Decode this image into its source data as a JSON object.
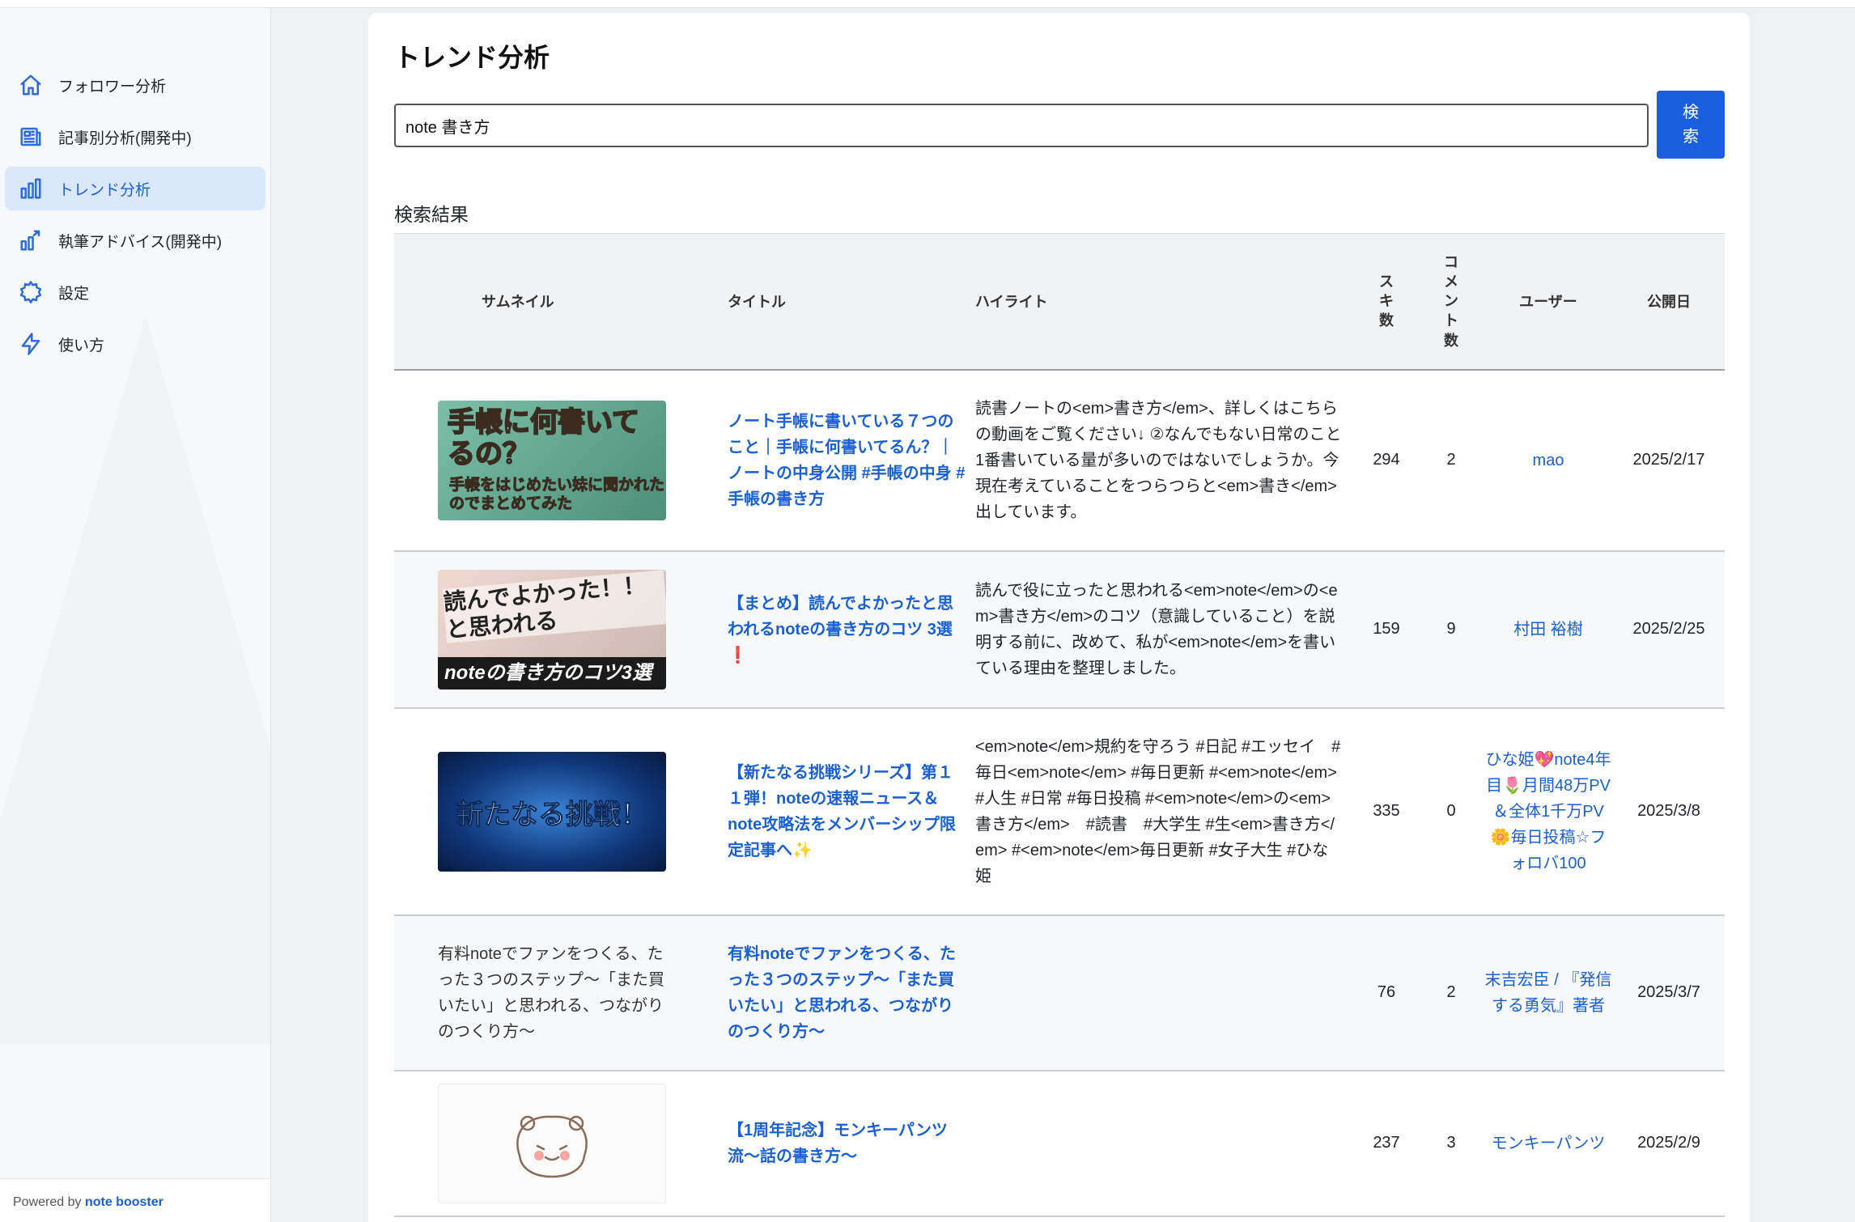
{
  "sidebar": {
    "items": [
      {
        "label": "フォロワー分析",
        "icon": "home-icon"
      },
      {
        "label": "記事別分析(開発中)",
        "icon": "article-icon"
      },
      {
        "label": "トレンド分析",
        "icon": "bar-chart-icon",
        "active": true
      },
      {
        "label": "執筆アドバイス(開発中)",
        "icon": "chart-growth-icon"
      },
      {
        "label": "設定",
        "icon": "gear-icon"
      },
      {
        "label": "使い方",
        "icon": "lightning-icon"
      }
    ],
    "powered_prefix": "Powered by",
    "powered_brand": "note booster"
  },
  "page": {
    "title": "トレンド分析",
    "search_value": "note 書き方",
    "search_button": "検索",
    "results_label": "検索結果"
  },
  "table": {
    "headers": {
      "thumb": "サムネイル",
      "title": "タイトル",
      "highlight": "ハイライト",
      "suki": "スキ数",
      "comments": "コメント数",
      "user": "ユーザー",
      "date": "公開日"
    },
    "rows": [
      {
        "thumb_text": "手帳に何書いてるの？",
        "thumb_sub": "手帳をはじめたい妹に聞かれたのでまとめてみた",
        "title": "ノート手帳に書いている７つのこと｜手帳に何書いてるん？｜ノートの中身公開 #手帳の中身 #手帳の書き方",
        "highlight": "読書ノートの<em>書き方</em>、詳しくはこちらの動画をご覧ください↓ ②なんでもない日常のこと 1番書いている量が多いのではないでしょうか。今現在考えていることをつらつらと<em>書き</em>出しています。",
        "suki": "294",
        "comments": "2",
        "user": "mao",
        "date": "2025/2/17"
      },
      {
        "thumb_text": "読んでよかった！！と思われる",
        "thumb_sub": "noteの書き方のコツ3選",
        "title": "【まとめ】読んでよかったと思われるnoteの書き方のコツ 3選❗",
        "highlight": "読んで役に立ったと思われる<em>note</em>の<em>書き方</em>のコツ（意識していること）を説明する前に、改めて、私が<em>note</em>を書いている理由を整理しました。",
        "suki": "159",
        "comments": "9",
        "user": "村田 裕樹",
        "date": "2025/2/25"
      },
      {
        "thumb_text": "新たなる挑戦！",
        "title": "【新たなる挑戦シリーズ】第１１弾！noteの速報ニュース＆note攻略法をメンバーシップ限定記事へ✨",
        "highlight": "<em>note</em>規約を守ろう #日記 #エッセイ　#毎日<em>note</em> #毎日更新 #<em>note</em> #人生 #日常 #毎日投稿 #<em>note</em>の<em>書き方</em>　#読書　#大学生 #生<em>書き方</em> #<em>note</em>毎日更新 #女子大生 #ひな姫",
        "suki": "335",
        "comments": "0",
        "user": "ひな姫💖note4年目🌷月間48万PV＆全体1千万PV🌼毎日投稿☆フォロバ100",
        "date": "2025/3/8"
      },
      {
        "thumb_alt": "有料noteでファンをつくる、たった３つのステップ〜「また買いたい」と思われる、つながりのつくり方〜",
        "title": "有料noteでファンをつくる、たった３つのステップ〜「また買いたい」と思われる、つながりのつくり方〜",
        "highlight": "",
        "suki": "76",
        "comments": "2",
        "user": "末吉宏臣 / 『発信する勇気』著者",
        "date": "2025/3/7"
      },
      {
        "title": "【1周年記念】モンキーパンツ流〜話の書き方〜",
        "highlight": "",
        "suki": "237",
        "comments": "3",
        "user": "モンキーパンツ",
        "date": "2025/2/9"
      }
    ]
  },
  "colors": {
    "accent": "#1a5fe0",
    "link": "#1a5fd6",
    "active_bg": "#dbe8fb"
  }
}
